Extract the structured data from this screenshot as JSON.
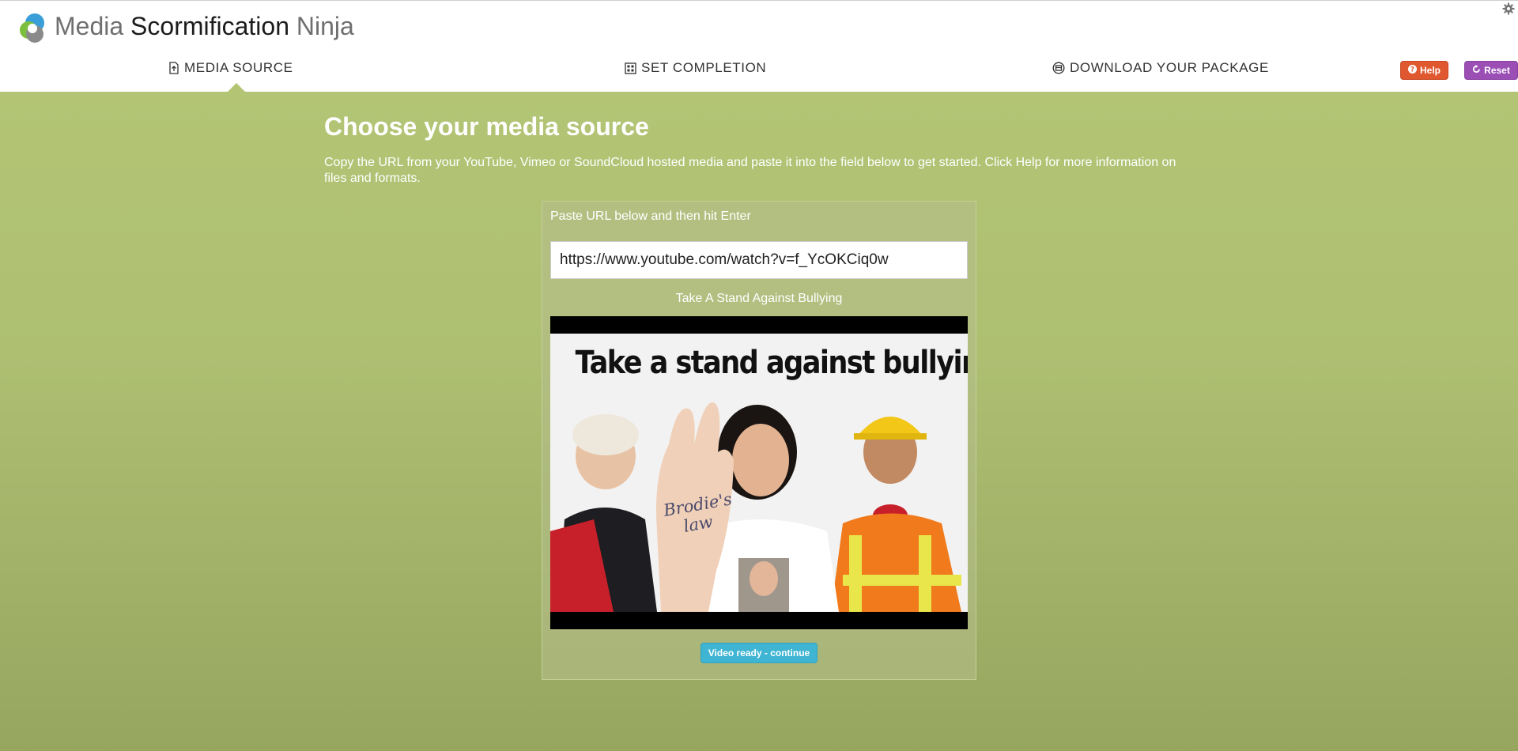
{
  "app": {
    "title_part1": "Media",
    "title_part2": "Scormification",
    "title_part3": "Ninja"
  },
  "nav": {
    "tabs": [
      {
        "label": "MEDIA SOURCE",
        "icon": "upload-file-icon",
        "active": true
      },
      {
        "label": "SET COMPLETION",
        "icon": "checklist-icon",
        "active": false
      },
      {
        "label": "DOWNLOAD YOUR PACKAGE",
        "icon": "package-icon",
        "active": false
      }
    ]
  },
  "toolbar": {
    "help_label": "Help",
    "reset_label": "Reset",
    "help_color": "#e0582f",
    "reset_color": "#9b4fb5"
  },
  "main": {
    "heading": "Choose your media source",
    "intro": "Copy the URL from your YouTube, Vimeo or SoundCloud hosted media and paste it into the field below to get started. Click Help for more information on files and formats.",
    "background_color": "#b3c475"
  },
  "source_card": {
    "label": "Paste URL below and then hit Enter",
    "url_value": "https://www.youtube.com/watch?v=f_YcOKCiq0w",
    "video_title": "Take A Stand Against Bullying",
    "thumbnail_caption": "Take a stand against bullying",
    "palm_text_line1": "Brodie's",
    "palm_text_line2": "law",
    "continue_label": "Video ready - continue",
    "continue_color": "#3fb5d3"
  }
}
